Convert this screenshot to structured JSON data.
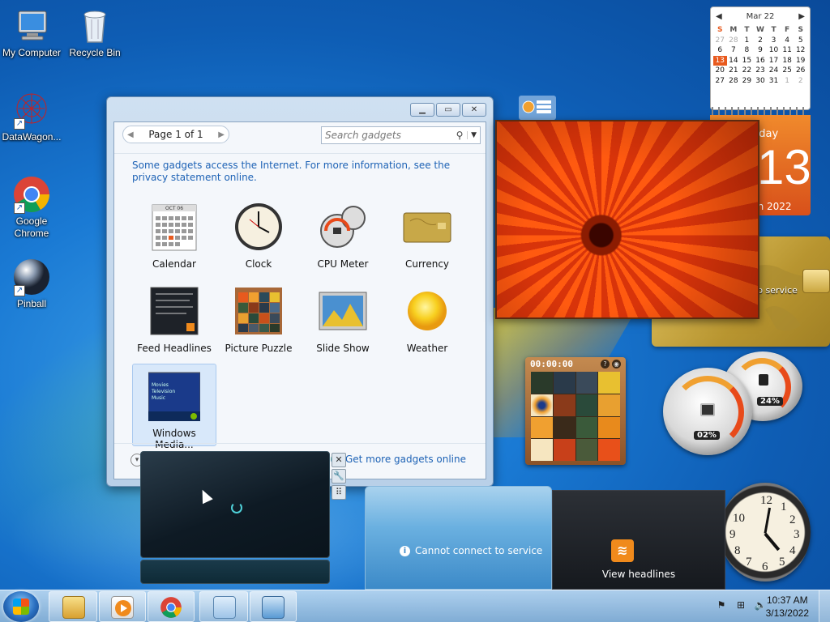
{
  "desktop": {
    "icons": [
      {
        "label": "My Computer",
        "icon": "computer-icon"
      },
      {
        "label": "Recycle Bin",
        "icon": "recycle-bin-icon"
      },
      {
        "label": "DataWagon...",
        "icon": "datawagon-icon"
      },
      {
        "label": "Google Chrome",
        "icon": "chrome-icon"
      },
      {
        "label": "Pinball",
        "icon": "pinball-icon"
      }
    ]
  },
  "gallery": {
    "page_label": "Page 1 of 1",
    "search_placeholder": "Search gadgets",
    "info_text": "Some gadgets access the Internet.  For more information, see the privacy statement online.",
    "gadgets": [
      {
        "label": "Calendar",
        "icon": "calendar-icon"
      },
      {
        "label": "Clock",
        "icon": "clock-icon"
      },
      {
        "label": "CPU Meter",
        "icon": "cpu-meter-icon"
      },
      {
        "label": "Currency",
        "icon": "currency-icon"
      },
      {
        "label": "Feed Headlines",
        "icon": "feed-headlines-icon"
      },
      {
        "label": "Picture Puzzle",
        "icon": "picture-puzzle-icon"
      },
      {
        "label": "Slide Show",
        "icon": "slide-show-icon"
      },
      {
        "label": "Weather",
        "icon": "weather-icon"
      },
      {
        "label": "Windows Media...",
        "icon": "windows-media-icon",
        "selected": true
      }
    ],
    "get_more": "Get more gadgets online",
    "thumb_calendar_month": "OCT 06",
    "thumb_wmc_lines": [
      "Movies",
      "Television",
      "Music"
    ]
  },
  "calendar_gadget": {
    "month": "Mar 22",
    "dow": [
      "S",
      "M",
      "T",
      "W",
      "T",
      "F",
      "S"
    ],
    "weeks": [
      [
        "27",
        "28",
        "1",
        "2",
        "3",
        "4",
        "5"
      ],
      [
        "6",
        "7",
        "8",
        "9",
        "10",
        "11",
        "12"
      ],
      [
        "13",
        "14",
        "15",
        "16",
        "17",
        "18",
        "19"
      ],
      [
        "20",
        "21",
        "22",
        "23",
        "24",
        "25",
        "26"
      ],
      [
        "27",
        "28",
        "29",
        "30",
        "31",
        "1",
        "2"
      ]
    ],
    "today": "13",
    "weekday_partial": "nday",
    "big_day": "13",
    "month_year_partial": "ch 2022"
  },
  "currency_gadget": {
    "message_partial": "to service"
  },
  "puzzle_gadget": {
    "timer": "00:00:00"
  },
  "cpu_gadget": {
    "cpu_percent": "02%",
    "memory_percent": "24%"
  },
  "weather_gadget": {
    "message": "Cannot connect to service"
  },
  "feed_gadget": {
    "label": "View headlines"
  },
  "taskbar": {
    "time": "10:37 AM",
    "date": "3/13/2022",
    "pinned": [
      "explorer-icon",
      "media-player-icon",
      "chrome-icon",
      "gadgets-icon",
      "remote-desktop-icon"
    ]
  },
  "colors": {
    "accent": "#1d62b5",
    "calendar_orange": "#e85a1e"
  }
}
